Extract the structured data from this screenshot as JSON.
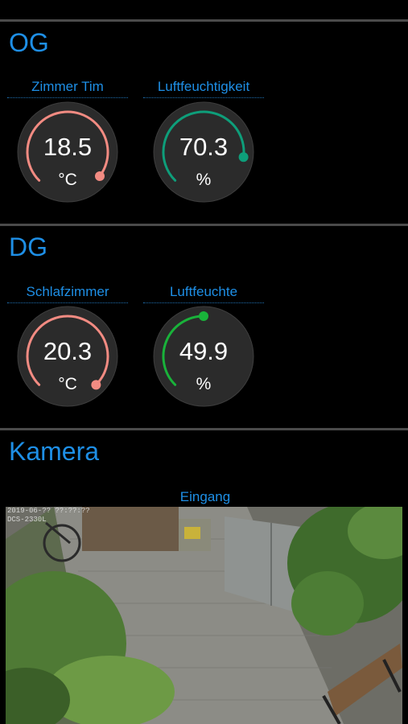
{
  "sections": [
    {
      "title": "OG",
      "gauges": [
        {
          "label": "Zimmer Tim",
          "value": "18.5",
          "unit": "°C",
          "level": 0.97,
          "color": "#f28b82"
        },
        {
          "label": "Luftfeuchtigkeit",
          "value": "70.3",
          "unit": "%",
          "level": 0.86,
          "color": "#0e9e7a"
        }
      ]
    },
    {
      "title": "DG",
      "gauges": [
        {
          "label": "Schlafzimmer",
          "value": "20.3",
          "unit": "°C",
          "level": 1.0,
          "color": "#f28b82"
        },
        {
          "label": "Luftfeuchte",
          "value": "49.9",
          "unit": "%",
          "level": 0.5,
          "color": "#19b23a"
        }
      ]
    },
    {
      "title": "Kamera",
      "camera": {
        "label": "Eingang",
        "osd_line1": "2019-06-?? ??:??:??",
        "osd_line2": "DCS-2330L"
      }
    }
  ]
}
